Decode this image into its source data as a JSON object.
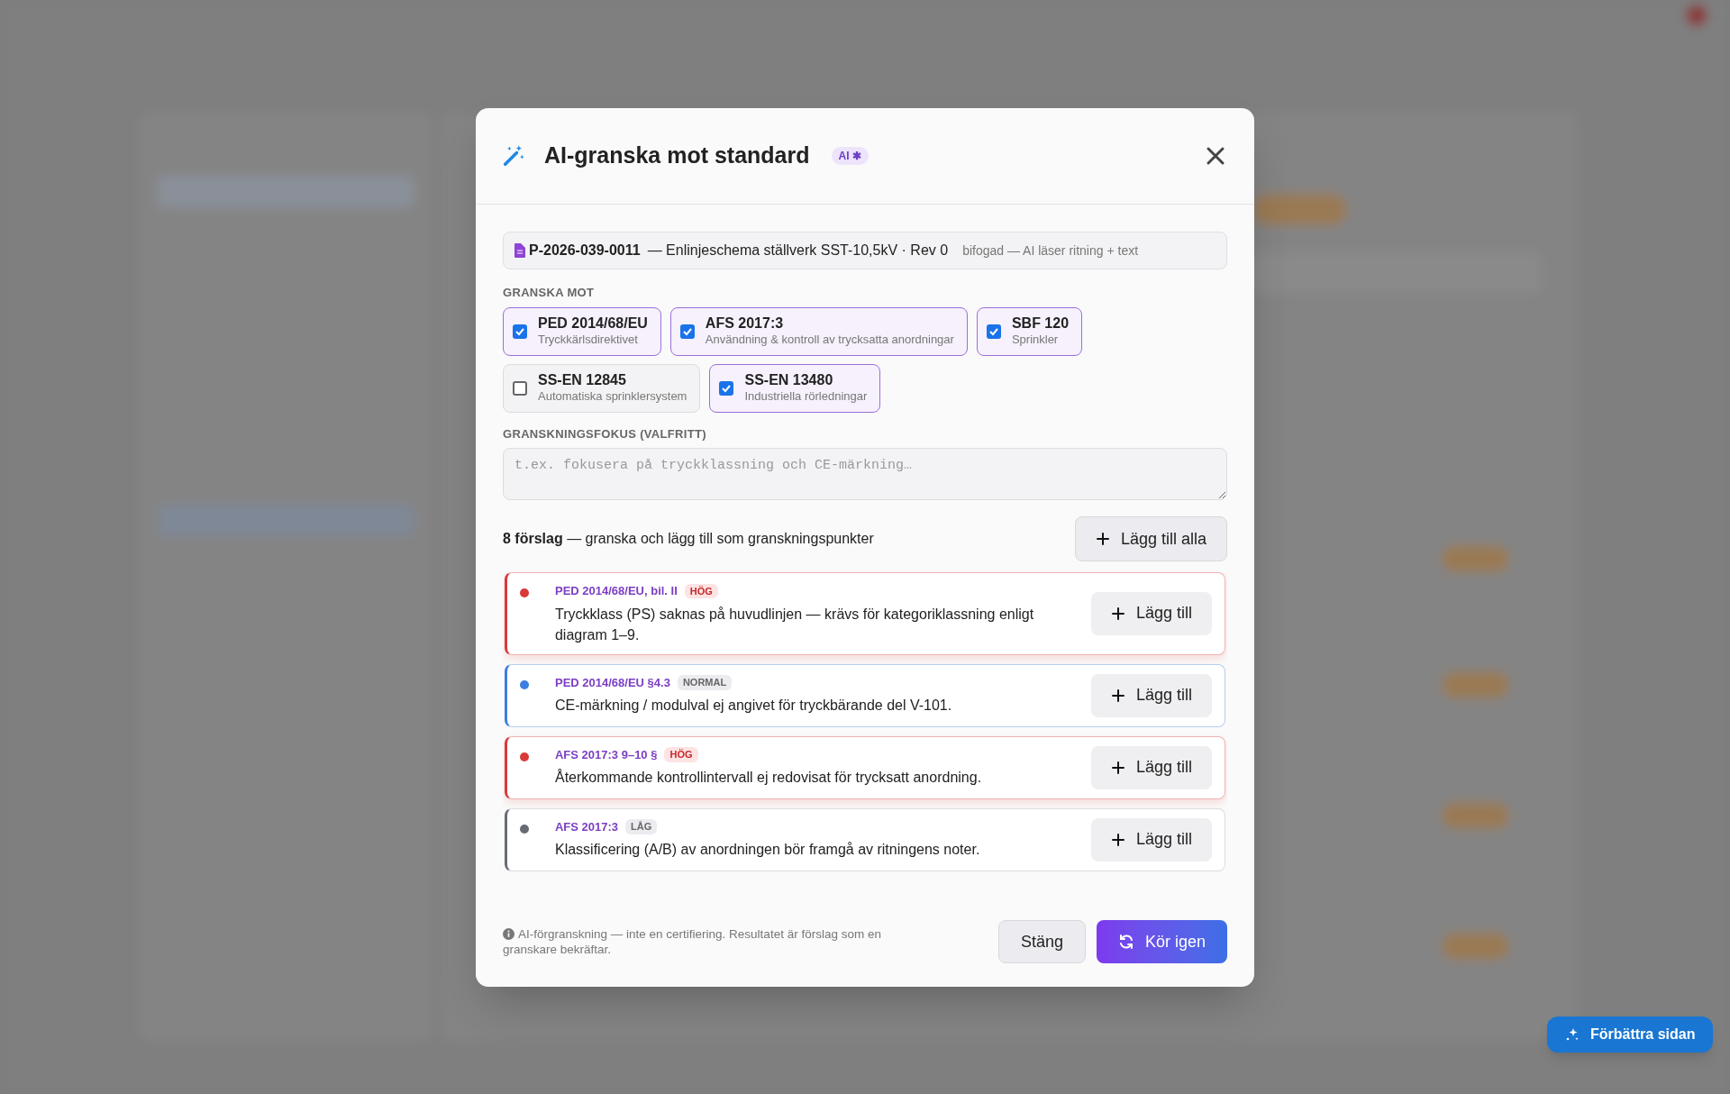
{
  "dialog": {
    "title": "AI-granska mot standard",
    "badge": "AI ✱",
    "document": {
      "id": "P-2026-039-0011",
      "description": "— Enlinjeschema ställverk SST-10,5kV · Rev 0",
      "note": "bifogad — AI läser ritning + text"
    },
    "standards_label": "GRANSKA MOT",
    "standards": [
      {
        "name": "PED 2014/68/EU",
        "subtitle": "Tryckkärlsdirektivet",
        "checked": true
      },
      {
        "name": "AFS 2017:3",
        "subtitle": "Användning & kontroll av trycksatta anordningar",
        "checked": true
      },
      {
        "name": "SBF 120",
        "subtitle": "Sprinkler",
        "checked": true
      },
      {
        "name": "SS-EN 12845",
        "subtitle": "Automatiska sprinklersystem",
        "checked": false
      },
      {
        "name": "SS-EN 13480",
        "subtitle": "Industriella rörledningar",
        "checked": true
      }
    ],
    "focus_label": "GRANSKNINGSFOKUS (VALFRITT)",
    "focus": {
      "placeholder": "t.ex. fokusera på tryckklassning och CE-märkning…"
    },
    "summary": "**8 förslag** — granska och lägg till som granskningspunkter",
    "add_all_button": "Lägg till alla",
    "suggestions": [
      {
        "reference": "PED 2014/68/EU, bil. II",
        "kind": "high",
        "priority_label": "HÖG",
        "text": "Tryckklass (PS) saknas på huvudlinjen — krävs för kategoriklassning enligt diagram 1–9.",
        "button": "Lägg till"
      },
      {
        "reference": "PED 2014/68/EU §4.3",
        "kind": "normal",
        "priority_label": "NORMAL",
        "text": "CE-märkning / modulval ej angivet för tryckbärande del V-101.",
        "button": "Lägg till"
      },
      {
        "reference": "AFS 2017:3 9–10 §",
        "kind": "high",
        "priority_label": "HÖG",
        "text": "Återkommande kontrollintervall ej redovisat för trycksatt anordning.",
        "button": "Lägg till"
      },
      {
        "reference": "AFS 2017:3",
        "kind": "low",
        "priority_label": "LÅG",
        "text": "Klassificering (A/B) av anordningen bör framgå av ritningens noter.",
        "button": "Lägg till"
      }
    ],
    "disclaimer": "AI-förgranskning — inte en certifiering. Resultatet är förslag som en granskare bekräftar.",
    "close_button": "Stäng",
    "rerun_button": "Kör igen"
  },
  "floating_button": "Förbättra sidan"
}
